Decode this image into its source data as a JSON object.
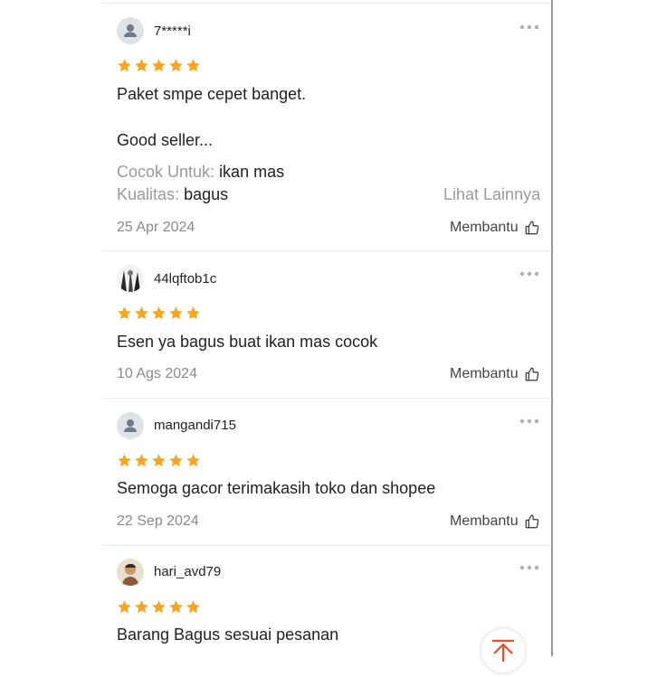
{
  "reviews": [
    {
      "username": "7*****i",
      "rating": 5,
      "text_lines": [
        "Paket smpe cepet banget.",
        "Good seller..."
      ],
      "attributes": [
        {
          "label": "Cocok Untuk:",
          "value": "ikan mas"
        },
        {
          "label": "Kualitas:",
          "value": "bagus"
        }
      ],
      "see_more": "Lihat Lainnya",
      "date": "25 Apr 2024",
      "helpful": "Membantu"
    },
    {
      "username": "44lqftob1c",
      "rating": 5,
      "text_lines": [
        "Esen ya bagus buat ikan mas cocok"
      ],
      "date": "10 Ags 2024",
      "helpful": "Membantu"
    },
    {
      "username": "mangandi715",
      "rating": 5,
      "text_lines": [
        "Semoga gacor terimakasih toko dan shopee"
      ],
      "date": "22 Sep 2024",
      "helpful": "Membantu"
    },
    {
      "username": "hari_avd79",
      "rating": 5,
      "text_lines": [
        "Barang Bagus sesuai pesanan"
      ]
    }
  ],
  "colors": {
    "star": "#F6A623",
    "scroll_top_icon": "#EE4D2D",
    "muted_text": "#9a9a9a"
  },
  "icons": {
    "more": "more-dots-icon",
    "helpful": "thumbs-up-icon",
    "scroll_top": "scroll-to-top-icon"
  }
}
